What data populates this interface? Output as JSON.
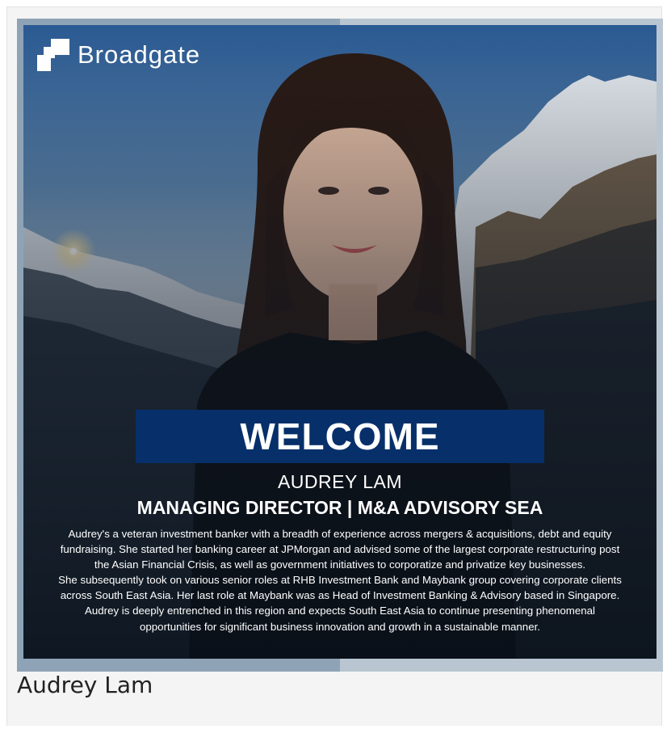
{
  "poster": {
    "brand": "Broadgate",
    "welcome": "WELCOME",
    "name": "AUDREY LAM",
    "role": "MANAGING DIRECTOR | M&A ADVISORY SEA",
    "bio": [
      "Audrey's a veteran investment banker with a breadth of experience across mergers & acquisitions, debt and equity",
      "fundraising.  She started her banking career at JPMorgan and advised some of the largest corporate restructuring post",
      "the Asian Financial Crisis, as well as government initiatives to corporatize and privatize key businesses.",
      "She subsequently took on various senior roles at RHB Investment Bank and Maybank group covering corporate clients",
      "across South East Asia. Her last role at Maybank was as Head of Investment Banking & Advisory based in Singapore.",
      "Audrey is deeply entrenched in this region and expects South East Asia to continue presenting phenomenal",
      "opportunities for significant business innovation and growth in a sustainable manner."
    ]
  },
  "caption": "Audrey Lam",
  "colors": {
    "welcome_bar": "#07306a",
    "frame_left": "#8fa3b7",
    "frame_right": "#b9c6d2"
  },
  "icons": {
    "logo": "broadgate-logo-icon"
  }
}
